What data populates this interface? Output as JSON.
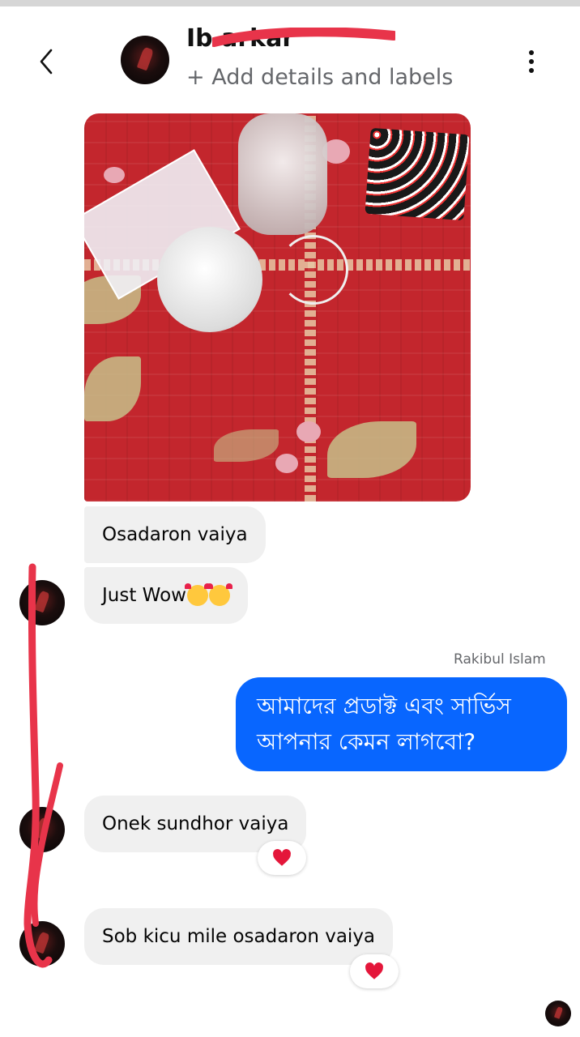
{
  "header": {
    "title": "Ib                    arkar",
    "subtitle": "+ Add details and labels",
    "back_icon": "chevron-left-icon",
    "more_icon": "vertical-dots-icon"
  },
  "messages": [
    {
      "text": "Osadaron vaiya"
    },
    {
      "text": "Just Wow"
    },
    {
      "sender": "Rakibul Islam",
      "text": "আমাদের প্রডাক্ট এবং সার্ভিস\nআপনার কেমন লাগবো?"
    },
    {
      "text": "Onek sundhor vaiya",
      "reaction": "heart"
    },
    {
      "text": "Sob kicu mile osadaron vaiya",
      "reaction": "heart"
    }
  ],
  "colors": {
    "outgoing": "#0866ff",
    "incoming": "#f0f0f0",
    "annotation": "#e8344a",
    "reaction_heart": "#e4163a"
  }
}
